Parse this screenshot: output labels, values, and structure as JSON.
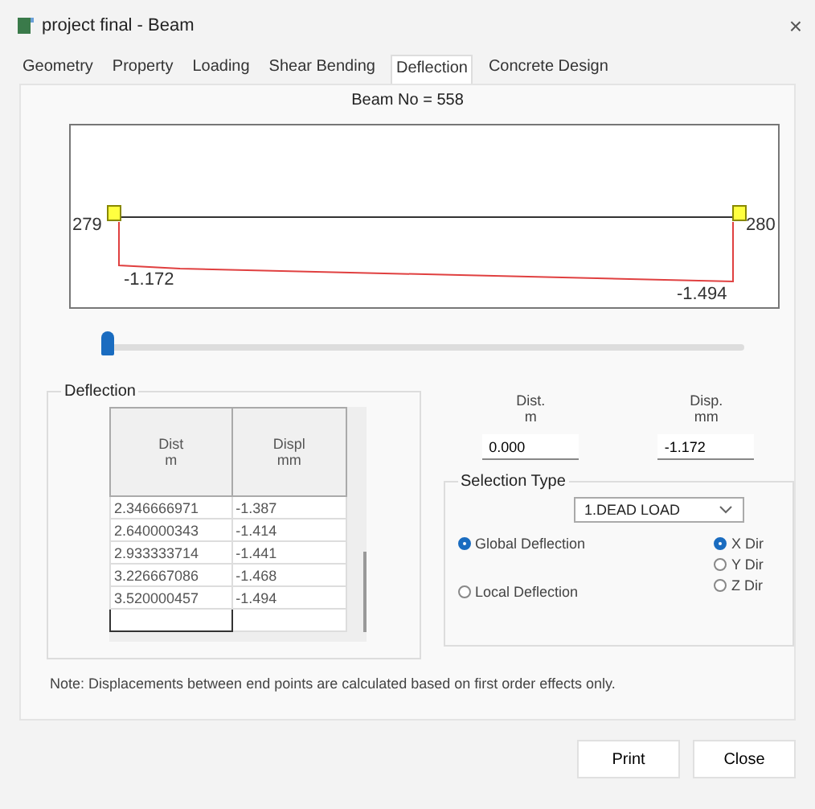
{
  "window": {
    "title": "project final - Beam",
    "close": "×"
  },
  "tabs": [
    {
      "label": "Geometry",
      "selected": false
    },
    {
      "label": "Property",
      "selected": false
    },
    {
      "label": "Loading",
      "selected": false
    },
    {
      "label": "Shear Bending",
      "selected": false
    },
    {
      "label": "Deflection",
      "selected": true
    },
    {
      "label": "Concrete Design",
      "selected": false
    }
  ],
  "beam_label": "Beam No = 558",
  "diagram": {
    "start_node": "279",
    "end_node": "280",
    "start_value": "-1.172",
    "end_value": "-1.494"
  },
  "slider": {
    "level": 0.0
  },
  "deflection_group": {
    "title": "Deflection",
    "columns": [
      "Dist\nm",
      "Displ\nmm"
    ],
    "rows": [
      [
        "2.346666971",
        "-1.387"
      ],
      [
        "2.640000343",
        "-1.414"
      ],
      [
        "2.933333714",
        "-1.441"
      ],
      [
        "3.226667086",
        "-1.468"
      ],
      [
        "3.520000457",
        "-1.494"
      ]
    ]
  },
  "readout": {
    "dist_label": "Dist.\nm",
    "disp_label": "Disp.\nmm",
    "dist_value": "0.000",
    "disp_value": "-1.172"
  },
  "selection": {
    "title": "Selection Type",
    "load_case": "1.DEAD LOAD",
    "modes": [
      {
        "label": "Global Deflection",
        "selected": true
      },
      {
        "label": "Local Deflection",
        "selected": false
      }
    ],
    "directions": [
      {
        "label": "X Dir",
        "selected": true
      },
      {
        "label": "Y Dir",
        "selected": false
      },
      {
        "label": "Z Dir",
        "selected": false
      }
    ]
  },
  "note": "Note: Displacements between end points are calculated based on first order effects only.",
  "buttons": [
    "Print",
    "Close"
  ]
}
